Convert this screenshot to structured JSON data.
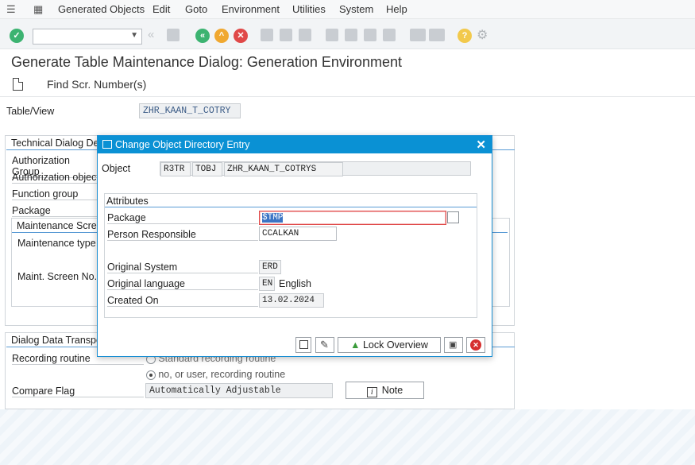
{
  "menubar": {
    "items": [
      "Generated Objects",
      "Edit",
      "Goto",
      "Environment",
      "Utilities",
      "System",
      "Help"
    ]
  },
  "toolbar": {
    "command_field_value": "",
    "colors": {
      "green": "#3cb371",
      "orange": "#f0a830",
      "red": "#e04848",
      "yellow": "#f2c94c"
    }
  },
  "page": {
    "title": "Generate Table Maintenance Dialog: Generation Environment",
    "find_label": "Find Scr. Number(s)"
  },
  "main": {
    "table_view_label": "Table/View",
    "table_view_value": "ZHR_KAAN_T_COTRY",
    "technical_group_title": "Technical Dialog Det",
    "tech_labels": [
      "Authorization Group",
      "Authorization object",
      "Function group",
      "Package"
    ],
    "maint_screen_title": "Maintenance Scree",
    "maint_labels": [
      "Maintenance type",
      "Maint. Screen No."
    ],
    "transport_group_title": "Dialog Data Transpo",
    "recording_routine_label": "Recording routine",
    "radio_standard": "Standard recording routine",
    "radio_user": "no, or user, recording routine",
    "compare_flag_label": "Compare Flag",
    "compare_flag_value": "Automatically Adjustable",
    "note_button": "Note"
  },
  "dialog": {
    "title": "Change Object Directory Entry",
    "object_label": "Object",
    "object_pgmid": "R3TR",
    "object_type": "TOBJ",
    "object_name": "ZHR_KAAN_T_COTRYS",
    "attributes_title": "Attributes",
    "package_label": "Package",
    "package_value": "$TMP",
    "person_label": "Person Responsible",
    "person_value": "CCALKAN",
    "orig_system_label": "Original System",
    "orig_system_value": "ERD",
    "orig_lang_label": "Original language",
    "orig_lang_code": "EN",
    "orig_lang_name": "English",
    "created_label": "Created On",
    "created_value": "13.02.2024",
    "lock_overview_button": "Lock Overview"
  }
}
